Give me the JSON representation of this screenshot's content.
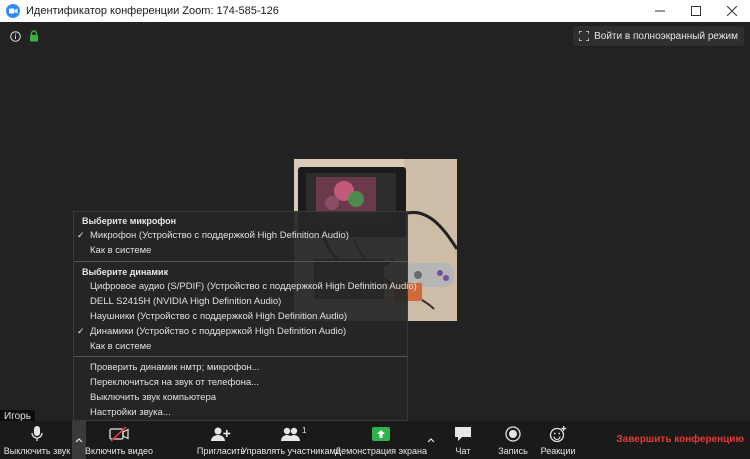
{
  "window": {
    "title": "Идентификатор конференции Zoom: 174-585-126",
    "minimize": "—",
    "maximize": "☐",
    "close": "✕"
  },
  "meeting": {
    "fullscreen_label": "Войти в полноэкранный режим",
    "participant_name": "Игорь"
  },
  "audio_menu": {
    "mic_section": "Выберите микрофон",
    "mic_items": [
      {
        "label": "Микрофон (Устройство с поддержкой High Definition Audio)",
        "checked": true
      },
      {
        "label": "Как в системе",
        "checked": false
      }
    ],
    "speaker_section": "Выберите динамик",
    "speaker_items": [
      {
        "label": "Цифровое аудио (S/PDIF) (Устройство с поддержкой High Definition Audio)",
        "checked": false
      },
      {
        "label": "DELL S2415H (NVIDIA High Definition Audio)",
        "checked": false
      },
      {
        "label": "Наушники (Устройство с поддержкой High Definition Audio)",
        "checked": false
      },
      {
        "label": "Динамики (Устройство с поддержкой High Definition Audio)",
        "checked": true
      },
      {
        "label": "Как в системе",
        "checked": false
      }
    ],
    "actions": [
      "Проверить динамик нмтр; микрофон...",
      "Переключиться на звук от телефона...",
      "Выключить звук компьютера",
      "Настройки звука..."
    ],
    "check_glyph": "✓"
  },
  "toolbar": {
    "mute": "Выключить звук",
    "video": "Включить видео",
    "invite": "Пригласить",
    "participants": "Управлять участниками",
    "participants_count": "1",
    "share": "Демонстрация экрана",
    "chat": "Чат",
    "record": "Запись",
    "reactions": "Реакции",
    "end": "Завершить конференцию",
    "caret": "^"
  },
  "colors": {
    "share_green": "#2db34a",
    "end_red": "#e53935",
    "zoom_blue": "#2d8cff",
    "lock_green": "#3cb043"
  }
}
